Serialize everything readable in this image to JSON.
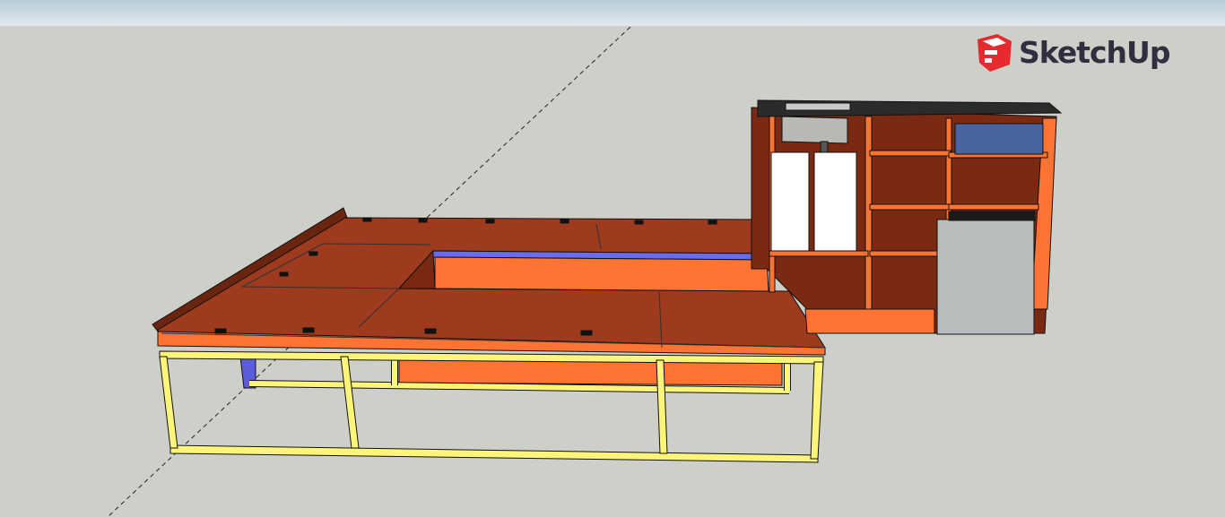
{
  "app": {
    "logo_text": "SketchUp"
  },
  "colors": {
    "sky": "#c9d8e0",
    "ground": "#cfcfca",
    "wood_top": "#9e3a1e",
    "wood_face": "#ff7433",
    "frame": "#fdf57a",
    "accent_blue": "#6b6bf0",
    "logo_red": "#e52b2f"
  }
}
